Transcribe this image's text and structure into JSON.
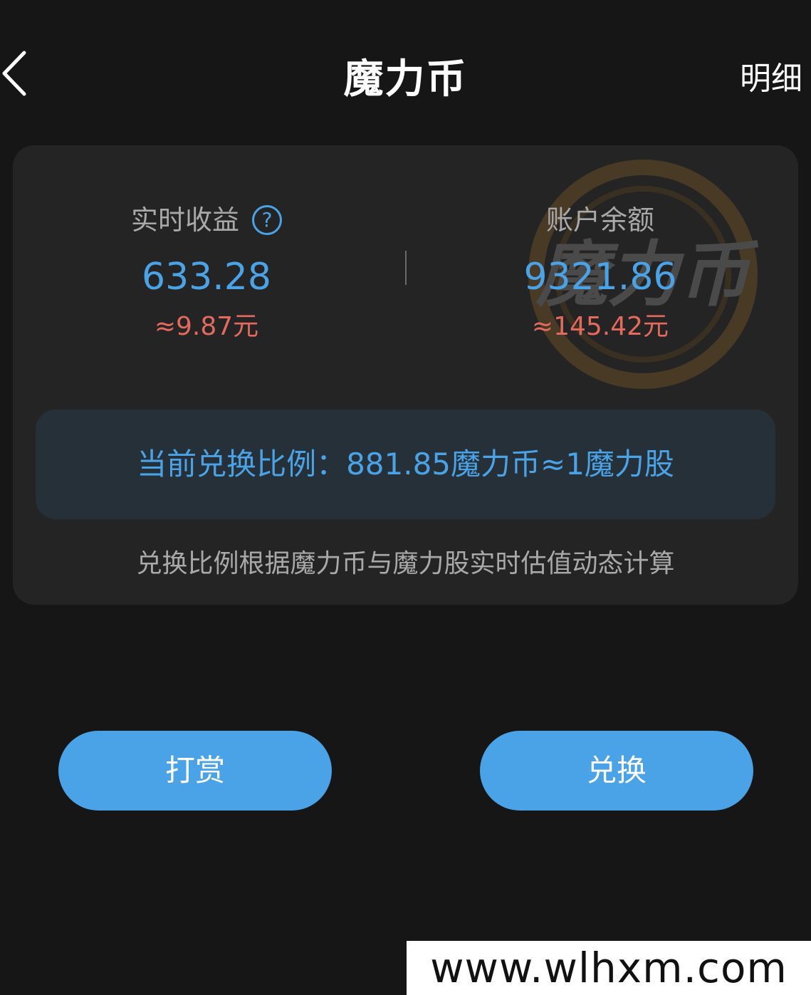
{
  "header": {
    "title": "魔力币",
    "detail_label": "明细"
  },
  "card": {
    "watermark_text": "魔力币",
    "realtime": {
      "label": "实时收益",
      "help_symbol": "?",
      "value": "633.28",
      "rmb": "≈9.87元"
    },
    "balance": {
      "label": "账户余额",
      "value": "9321.86",
      "rmb": "≈145.42元"
    },
    "ratio_text": "当前兑换比例：881.85魔力币≈1魔力股",
    "note": "兑换比例根据魔力币与魔力股实时估值动态计算"
  },
  "actions": {
    "tip_label": "打赏",
    "exchange_label": "兑换"
  },
  "site_watermark": "www.wlhxm.com",
  "colors": {
    "background": "#161616",
    "card": "#242424",
    "accent_blue": "#4aa3e6",
    "rmb_red": "#e46a5e",
    "ratio_box": "#253038"
  }
}
